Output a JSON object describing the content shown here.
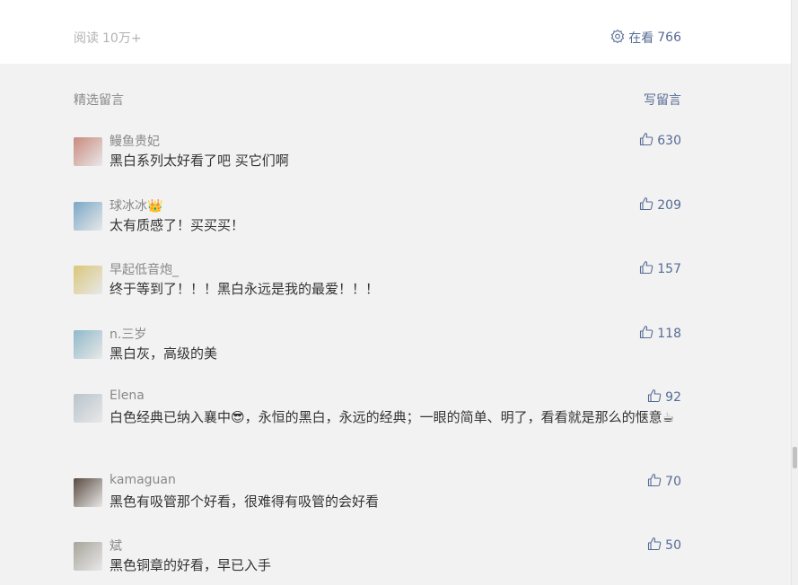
{
  "stats": {
    "read_label": "阅读",
    "read_value": "10万+",
    "watching_label": "在看",
    "watching_value": "766"
  },
  "comments_section": {
    "title": "精选留言",
    "write_label": "写留言"
  },
  "comments": [
    {
      "nickname": "鳗鱼贵妃",
      "text": "黑白系列太好看了吧 买它们啊",
      "likes": "630",
      "avatar": "#c98a7e"
    },
    {
      "nickname": "球冰冰👑",
      "text": "太有质感了！买买买！",
      "likes": "209",
      "avatar": "#7aa7c7"
    },
    {
      "nickname": "早起低音炮_",
      "text": "终于等到了！！！黑白永远是我的最爱！！！",
      "likes": "157",
      "avatar": "#d9c77a"
    },
    {
      "nickname": "n.三岁",
      "text": "黑白灰，高级的美",
      "likes": "118",
      "avatar": "#8fb9c9"
    },
    {
      "nickname": "Elena",
      "text": "白色经典已纳入襄中😎，永恒的黑白，永远的经典；一眼的简单、明了，看看就是那么的惬意☕",
      "likes": "92",
      "avatar": "#b8c4cc"
    },
    {
      "nickname": "kamaguan",
      "text": "黑色有吸管那个好看，很难得有吸管的会好看",
      "likes": "70",
      "avatar": "#5a4a40"
    },
    {
      "nickname": "斌",
      "text": "黑色铜章的好看，早已入手",
      "likes": "50",
      "avatar": "#a7a59a"
    }
  ]
}
